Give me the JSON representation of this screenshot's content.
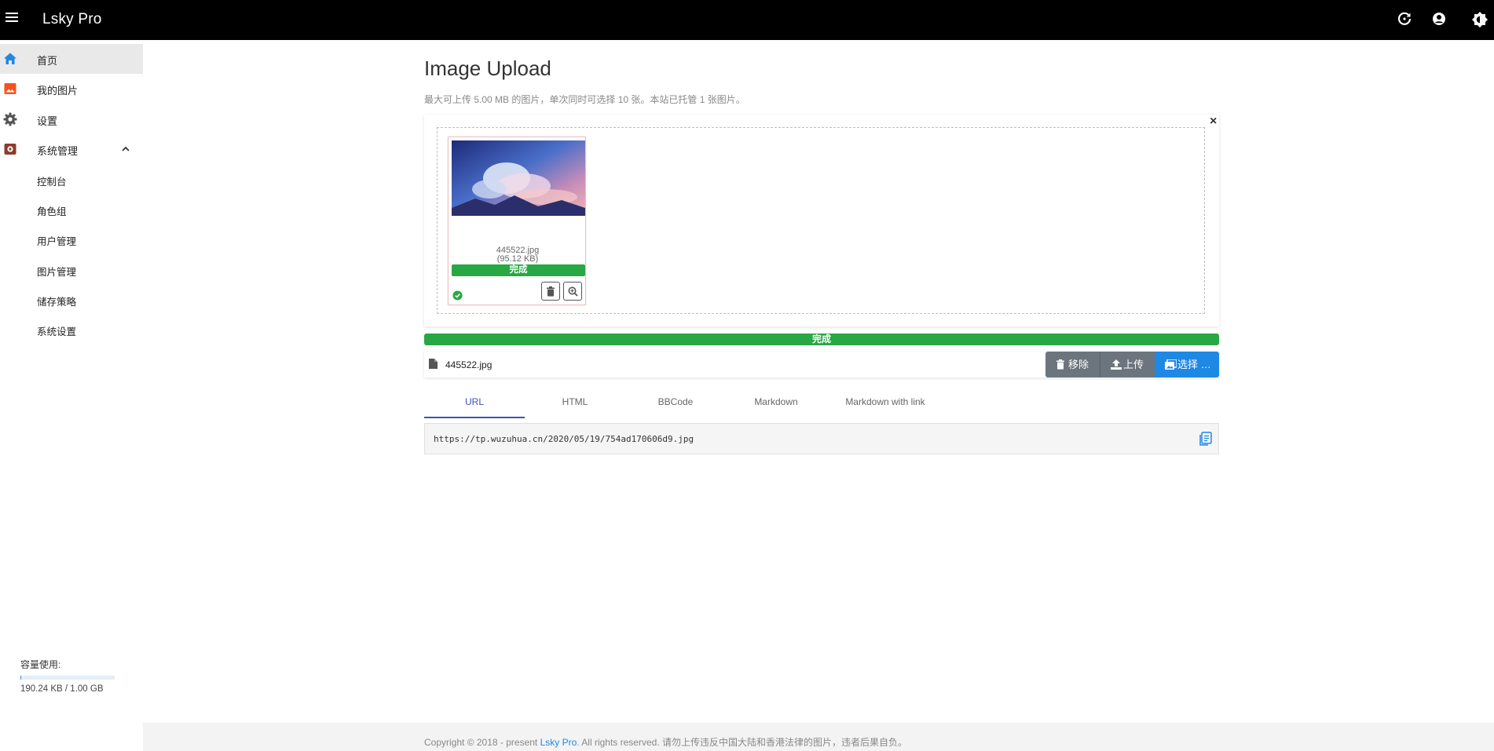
{
  "header": {
    "title": "Lsky Pro",
    "icons": [
      "menu-icon",
      "refresh-icon",
      "account-icon",
      "theme-icon"
    ]
  },
  "sidebar": {
    "items": [
      {
        "label": "首页",
        "icon": "home-icon",
        "color": "#1e88e5"
      },
      {
        "label": "我的图片",
        "icon": "image-icon",
        "color": "#f4511e"
      },
      {
        "label": "设置",
        "icon": "gear-icon",
        "color": "#555555"
      },
      {
        "label": "系统管理",
        "icon": "admin-icon",
        "color": "#8d3b2b"
      }
    ],
    "subitems": [
      {
        "label": "控制台"
      },
      {
        "label": "角色组"
      },
      {
        "label": "用户管理"
      },
      {
        "label": "图片管理"
      },
      {
        "label": "储存策略"
      },
      {
        "label": "系统设置"
      }
    ],
    "usage": {
      "title": "容量使用:",
      "text": "190.24 KB / 1.00 GB",
      "fraction": 0.0002
    }
  },
  "main": {
    "title": "Image Upload",
    "subtitle": "最大可上传 5.00 MB 的图片，单次同时可选择 10 张。本站已托管 1 张图片。",
    "close": "×",
    "preview": {
      "filename": "445522.jpg",
      "size": "(95.12 KB)",
      "progress_label": "完成",
      "status": "success"
    },
    "overall_progress": "完成",
    "file_caption": "445522.jpg",
    "buttons": {
      "remove": "移除",
      "upload": "上传",
      "choose": "选择 …"
    },
    "tabs": [
      {
        "label": "URL",
        "active": true
      },
      {
        "label": "HTML",
        "active": false
      },
      {
        "label": "BBCode",
        "active": false
      },
      {
        "label": "Markdown",
        "active": false
      },
      {
        "label": "Markdown with link",
        "active": false
      }
    ],
    "link": "https://tp.wuzuhua.cn/2020/05/19/754ad170606d9.jpg"
  },
  "footer": {
    "prefix": "Copyright © 2018 - present ",
    "link": "Lsky Pro",
    "suffix": ". All rights reserved. 请勿上传违反中国大陆和香港法律的图片，违者后果自负。"
  },
  "colors": {
    "accent": "#1e88e5",
    "success": "#28a745",
    "secondary": "#6c757d",
    "tab_active": "#3f51b5"
  }
}
